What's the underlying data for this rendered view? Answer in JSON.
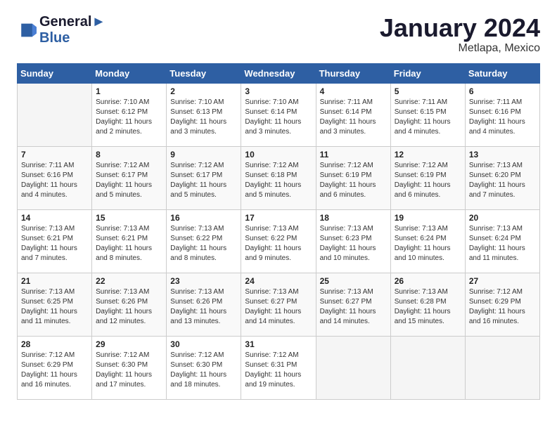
{
  "header": {
    "logo_line1": "General",
    "logo_line2": "Blue",
    "month_year": "January 2024",
    "location": "Metlapa, Mexico"
  },
  "weekdays": [
    "Sunday",
    "Monday",
    "Tuesday",
    "Wednesday",
    "Thursday",
    "Friday",
    "Saturday"
  ],
  "weeks": [
    [
      {
        "day": "",
        "empty": true
      },
      {
        "day": "1",
        "sunrise": "7:10 AM",
        "sunset": "6:12 PM",
        "daylight": "11 hours and 2 minutes."
      },
      {
        "day": "2",
        "sunrise": "7:10 AM",
        "sunset": "6:13 PM",
        "daylight": "11 hours and 3 minutes."
      },
      {
        "day": "3",
        "sunrise": "7:10 AM",
        "sunset": "6:14 PM",
        "daylight": "11 hours and 3 minutes."
      },
      {
        "day": "4",
        "sunrise": "7:11 AM",
        "sunset": "6:14 PM",
        "daylight": "11 hours and 3 minutes."
      },
      {
        "day": "5",
        "sunrise": "7:11 AM",
        "sunset": "6:15 PM",
        "daylight": "11 hours and 4 minutes."
      },
      {
        "day": "6",
        "sunrise": "7:11 AM",
        "sunset": "6:16 PM",
        "daylight": "11 hours and 4 minutes."
      }
    ],
    [
      {
        "day": "7",
        "sunrise": "7:11 AM",
        "sunset": "6:16 PM",
        "daylight": "11 hours and 4 minutes."
      },
      {
        "day": "8",
        "sunrise": "7:12 AM",
        "sunset": "6:17 PM",
        "daylight": "11 hours and 5 minutes."
      },
      {
        "day": "9",
        "sunrise": "7:12 AM",
        "sunset": "6:17 PM",
        "daylight": "11 hours and 5 minutes."
      },
      {
        "day": "10",
        "sunrise": "7:12 AM",
        "sunset": "6:18 PM",
        "daylight": "11 hours and 5 minutes."
      },
      {
        "day": "11",
        "sunrise": "7:12 AM",
        "sunset": "6:19 PM",
        "daylight": "11 hours and 6 minutes."
      },
      {
        "day": "12",
        "sunrise": "7:12 AM",
        "sunset": "6:19 PM",
        "daylight": "11 hours and 6 minutes."
      },
      {
        "day": "13",
        "sunrise": "7:13 AM",
        "sunset": "6:20 PM",
        "daylight": "11 hours and 7 minutes."
      }
    ],
    [
      {
        "day": "14",
        "sunrise": "7:13 AM",
        "sunset": "6:21 PM",
        "daylight": "11 hours and 7 minutes."
      },
      {
        "day": "15",
        "sunrise": "7:13 AM",
        "sunset": "6:21 PM",
        "daylight": "11 hours and 8 minutes."
      },
      {
        "day": "16",
        "sunrise": "7:13 AM",
        "sunset": "6:22 PM",
        "daylight": "11 hours and 8 minutes."
      },
      {
        "day": "17",
        "sunrise": "7:13 AM",
        "sunset": "6:22 PM",
        "daylight": "11 hours and 9 minutes."
      },
      {
        "day": "18",
        "sunrise": "7:13 AM",
        "sunset": "6:23 PM",
        "daylight": "11 hours and 10 minutes."
      },
      {
        "day": "19",
        "sunrise": "7:13 AM",
        "sunset": "6:24 PM",
        "daylight": "11 hours and 10 minutes."
      },
      {
        "day": "20",
        "sunrise": "7:13 AM",
        "sunset": "6:24 PM",
        "daylight": "11 hours and 11 minutes."
      }
    ],
    [
      {
        "day": "21",
        "sunrise": "7:13 AM",
        "sunset": "6:25 PM",
        "daylight": "11 hours and 11 minutes."
      },
      {
        "day": "22",
        "sunrise": "7:13 AM",
        "sunset": "6:26 PM",
        "daylight": "11 hours and 12 minutes."
      },
      {
        "day": "23",
        "sunrise": "7:13 AM",
        "sunset": "6:26 PM",
        "daylight": "11 hours and 13 minutes."
      },
      {
        "day": "24",
        "sunrise": "7:13 AM",
        "sunset": "6:27 PM",
        "daylight": "11 hours and 14 minutes."
      },
      {
        "day": "25",
        "sunrise": "7:13 AM",
        "sunset": "6:27 PM",
        "daylight": "11 hours and 14 minutes."
      },
      {
        "day": "26",
        "sunrise": "7:13 AM",
        "sunset": "6:28 PM",
        "daylight": "11 hours and 15 minutes."
      },
      {
        "day": "27",
        "sunrise": "7:12 AM",
        "sunset": "6:29 PM",
        "daylight": "11 hours and 16 minutes."
      }
    ],
    [
      {
        "day": "28",
        "sunrise": "7:12 AM",
        "sunset": "6:29 PM",
        "daylight": "11 hours and 16 minutes."
      },
      {
        "day": "29",
        "sunrise": "7:12 AM",
        "sunset": "6:30 PM",
        "daylight": "11 hours and 17 minutes."
      },
      {
        "day": "30",
        "sunrise": "7:12 AM",
        "sunset": "6:30 PM",
        "daylight": "11 hours and 18 minutes."
      },
      {
        "day": "31",
        "sunrise": "7:12 AM",
        "sunset": "6:31 PM",
        "daylight": "11 hours and 19 minutes."
      },
      {
        "day": "",
        "empty": true
      },
      {
        "day": "",
        "empty": true
      },
      {
        "day": "",
        "empty": true
      }
    ]
  ],
  "labels": {
    "sunrise": "Sunrise:",
    "sunset": "Sunset:",
    "daylight": "Daylight:"
  }
}
